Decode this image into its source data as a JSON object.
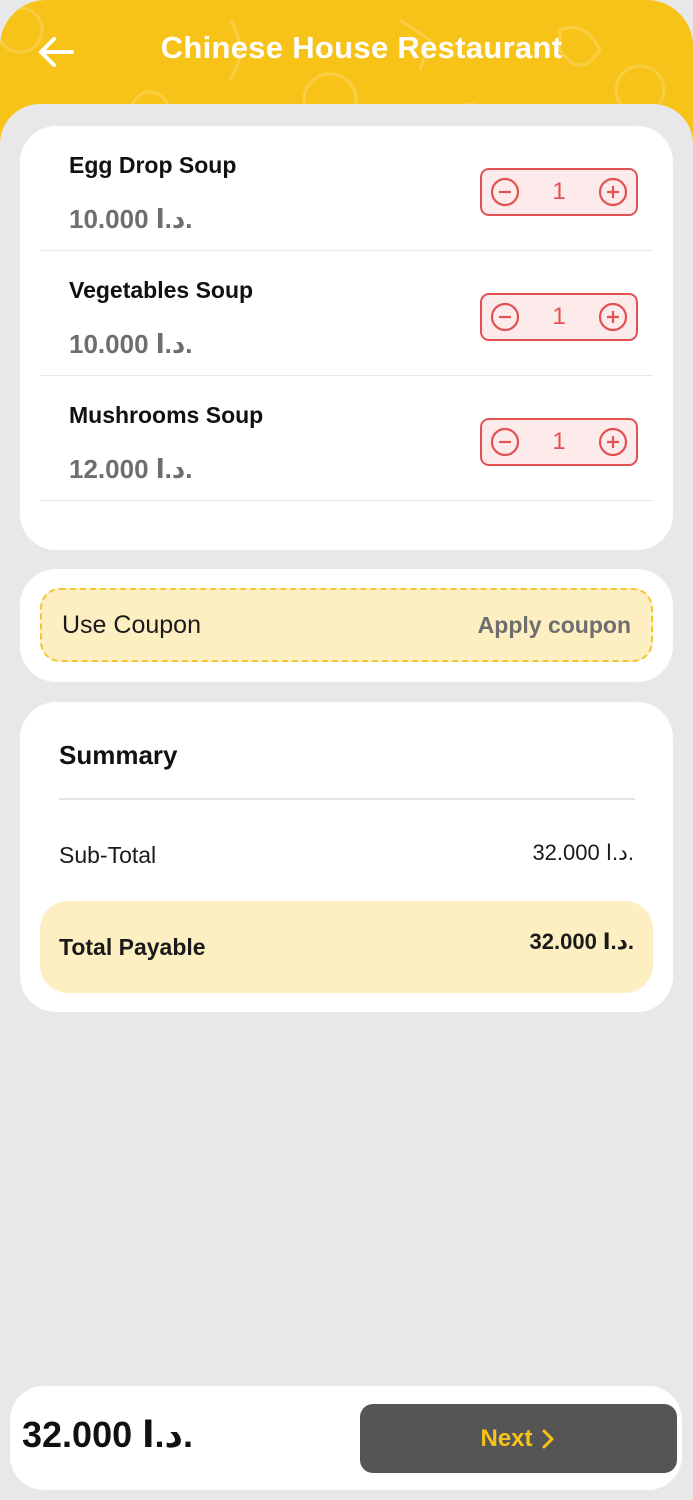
{
  "header": {
    "title": "Chinese House Restaurant",
    "back_icon": "arrow-left-icon",
    "color": "#f8c319"
  },
  "items": [
    {
      "name": "Egg Drop Soup",
      "price": "10.000 د.ا.",
      "quantity": "1"
    },
    {
      "name": "Vegetables Soup",
      "price": "10.000 د.ا.",
      "quantity": "1"
    },
    {
      "name": "Mushrooms Soup",
      "price": "12.000 د.ا.",
      "quantity": "1"
    }
  ],
  "coupon": {
    "label": "Use Coupon",
    "action": "Apply coupon"
  },
  "summary": {
    "title": "Summary",
    "subtotal_label": "Sub-Total",
    "subtotal_value": "32.000 د.ا.",
    "total_label": "Total Payable",
    "total_value": "32.000 د.ا."
  },
  "footer": {
    "total": "32.000 د.ا.",
    "next_label": "Next",
    "next_icon": "chevron-right-icon"
  },
  "colors": {
    "accent": "#f8c319",
    "stepper": "#e25252",
    "button": "#555555"
  }
}
